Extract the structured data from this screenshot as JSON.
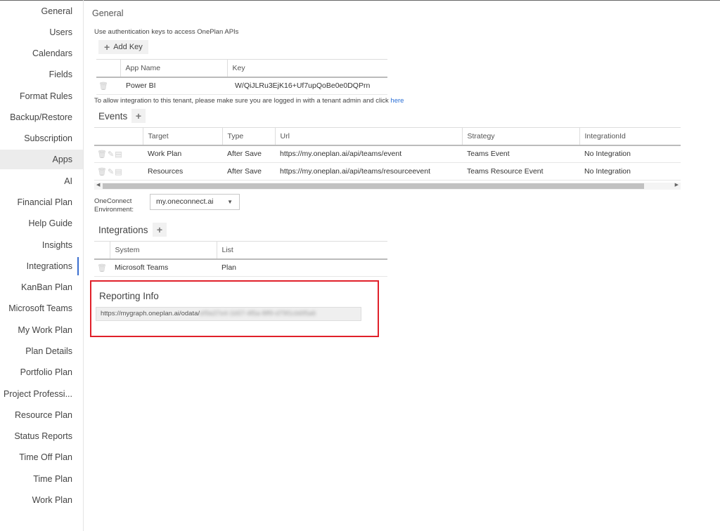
{
  "sidebar": {
    "items": [
      {
        "label": "General"
      },
      {
        "label": "Users"
      },
      {
        "label": "Calendars"
      },
      {
        "label": "Fields"
      },
      {
        "label": "Format Rules"
      },
      {
        "label": "Backup/Restore"
      },
      {
        "label": "Subscription"
      },
      {
        "label": "Apps"
      },
      {
        "label": "AI"
      },
      {
        "label": "Financial Plan"
      },
      {
        "label": "Help Guide"
      },
      {
        "label": "Insights"
      },
      {
        "label": "Integrations"
      },
      {
        "label": "KanBan Plan"
      },
      {
        "label": "Microsoft Teams"
      },
      {
        "label": "My Work Plan"
      },
      {
        "label": "Plan Details"
      },
      {
        "label": "Portfolio Plan"
      },
      {
        "label": "Project Professi..."
      },
      {
        "label": "Resource Plan"
      },
      {
        "label": "Status Reports"
      },
      {
        "label": "Time Off Plan"
      },
      {
        "label": "Time Plan"
      },
      {
        "label": "Work Plan"
      }
    ],
    "active": "Apps"
  },
  "general": {
    "title": "General",
    "description": "Use authentication keys to access OnePlan APIs",
    "add_key_label": "Add Key",
    "table": {
      "headers": [
        "App Name",
        "Key"
      ],
      "rows": [
        [
          "Power BI",
          "W/QiJLRu3EjK16+Uf7upQoBe0e0DQPrn"
        ]
      ]
    },
    "tenant_note": "To allow integration to this tenant, please make sure you are logged in with a tenant admin and click",
    "here_link": "here"
  },
  "events": {
    "title": "Events",
    "headers": [
      "Target",
      "Type",
      "Url",
      "Strategy",
      "IntegrationId"
    ],
    "rows": [
      [
        "Work Plan",
        "After Save",
        "https://my.oneplan.ai/api/teams/event",
        "Teams Event",
        "No Integration"
      ],
      [
        "Resources",
        "After Save",
        "https://my.oneplan.ai/api/teams/resourceevent",
        "Teams Resource Event",
        "No Integration"
      ]
    ]
  },
  "oneconnect": {
    "label_line1": "OneConnect",
    "label_line2": "Environment:",
    "selected": "my.oneconnect.ai"
  },
  "integrations": {
    "title": "Integrations",
    "headers": [
      "System",
      "List"
    ],
    "rows": [
      [
        "Microsoft Teams",
        "Plan"
      ]
    ]
  },
  "reporting": {
    "title": "Reporting Info",
    "url_prefix": "https://mygraph.oneplan.ai/odata/",
    "url_obscured": "ef9a37e4-1b57-4f5a-8ff9-d79f1cb6f5a6"
  },
  "icons": {
    "plus": "plus-icon",
    "trash": "trash-icon",
    "edit": "pencil-icon",
    "copy": "clipboard-icon"
  },
  "colors": {
    "highlight_border": "#e0202a",
    "link": "#2b6fd6",
    "active_indicator": "#3b6fcf"
  }
}
